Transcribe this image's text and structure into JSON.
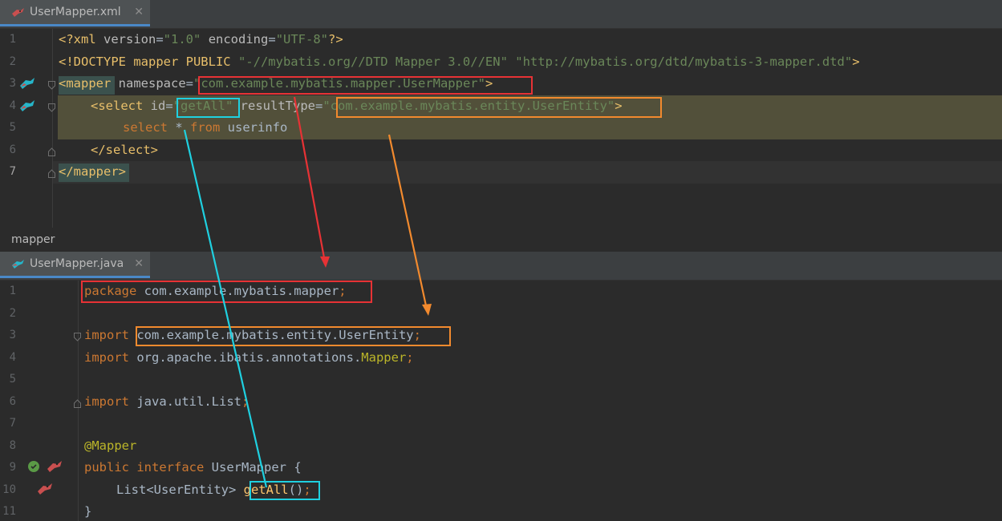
{
  "xml_tab": {
    "title": "UserMapper.xml",
    "close": "✕"
  },
  "xml_lines": [
    {
      "n": "1"
    },
    {
      "n": "2"
    },
    {
      "n": "3"
    },
    {
      "n": "4"
    },
    {
      "n": "5"
    },
    {
      "n": "6"
    },
    {
      "n": "7"
    }
  ],
  "xml_code": {
    "l1": {
      "a": "<?xml ",
      "b": "version",
      "c": "=",
      "d": "\"1.0\"",
      "e": " ",
      "f": "encoding",
      "g": "=",
      "h": "\"UTF-8\"",
      "i": "?>"
    },
    "l2": {
      "a": "<!DOCTYPE mapper PUBLIC ",
      "b": "\"-//mybatis.org//DTD Mapper 3.0//EN\"",
      "c": " ",
      "d": "\"http://mybatis.org/dtd/mybatis-3-mapper.dtd\"",
      "e": ">"
    },
    "l3": {
      "a": "<mapper",
      "b": " namespace",
      "c": "=",
      "d": "\"com.example.mybatis.mapper.UserMapper\"",
      "e": ">"
    },
    "l4": {
      "a": "<select",
      "b": " id",
      "c": "=",
      "d": "\"getAll\"",
      "e": " resultType",
      "f": "=",
      "g": "\"com.example.mybatis.entity.UserEntity\"",
      "h": ">"
    },
    "l5": {
      "a": "select",
      "b": " * ",
      "c": "from",
      "d": " userinfo"
    },
    "l6": {
      "a": "</select>"
    },
    "l7": {
      "a": "</mapper>"
    }
  },
  "breadcrumb": "mapper",
  "java_tab": {
    "title": "UserMapper.java",
    "close": "✕"
  },
  "java_lines": [
    {
      "n": "1"
    },
    {
      "n": "2"
    },
    {
      "n": "3"
    },
    {
      "n": "4"
    },
    {
      "n": "5"
    },
    {
      "n": "6"
    },
    {
      "n": "7"
    },
    {
      "n": "8"
    },
    {
      "n": "9"
    },
    {
      "n": "10"
    },
    {
      "n": "11"
    }
  ],
  "java_code": {
    "l1": {
      "a": "package",
      "b": " com.example.mybatis.mapper",
      "c": ";"
    },
    "l3": {
      "a": "import",
      "b": " com.example.mybatis.entity.UserEntity",
      "c": ";"
    },
    "l4": {
      "a": "import",
      "b": " org.apache.ibatis.annotations.",
      "c": "Mapper",
      "d": ";"
    },
    "l6": {
      "a": "import",
      "b": " java.util.List",
      "c": ";"
    },
    "l8": {
      "a": "@Mapper"
    },
    "l9": {
      "a": "public",
      "b": " ",
      "c": "interface",
      "d": " UserMapper {"
    },
    "l10": {
      "a": "List<UserEntity> ",
      "b": "getAll",
      "c": "()",
      "d": ";"
    },
    "l11": {
      "a": "}"
    }
  },
  "colors": {
    "red_box": "#e73235",
    "orange_box": "#f28a2e",
    "cyan_box": "#1fd0e0",
    "editor_bg": "#2b2b2b"
  },
  "icons": [
    "mybatis-bird-icon",
    "fold-marker-icon",
    "implemented-interface-icon"
  ]
}
